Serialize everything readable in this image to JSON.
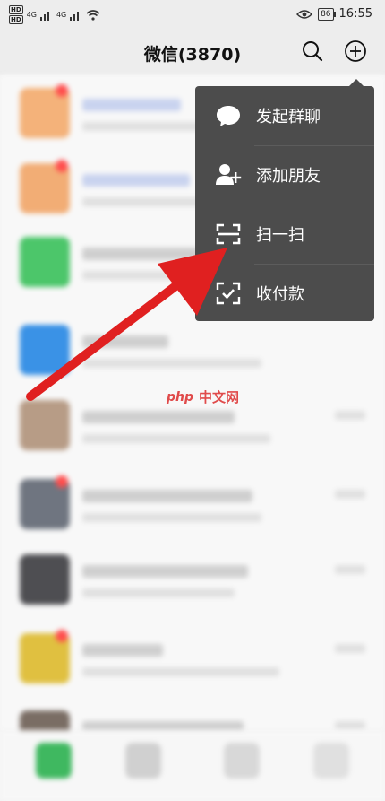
{
  "status_bar": {
    "hd1": "HD",
    "hd2": "HD",
    "net1": "4G",
    "net2": "4G",
    "battery": "86",
    "time": "16:55"
  },
  "header": {
    "title": "微信(3870)"
  },
  "menu": {
    "items": [
      {
        "label": "发起群聊",
        "icon": "chat-bubble-icon"
      },
      {
        "label": "添加朋友",
        "icon": "add-friend-icon"
      },
      {
        "label": "扫一扫",
        "icon": "scan-icon"
      },
      {
        "label": "收付款",
        "icon": "payment-icon"
      }
    ]
  },
  "watermark": {
    "logo": "php",
    "text": "中文网"
  },
  "colors": {
    "menu_bg": "#4c4c4c",
    "arrow": "#e02020",
    "header_bg": "#ededed"
  }
}
